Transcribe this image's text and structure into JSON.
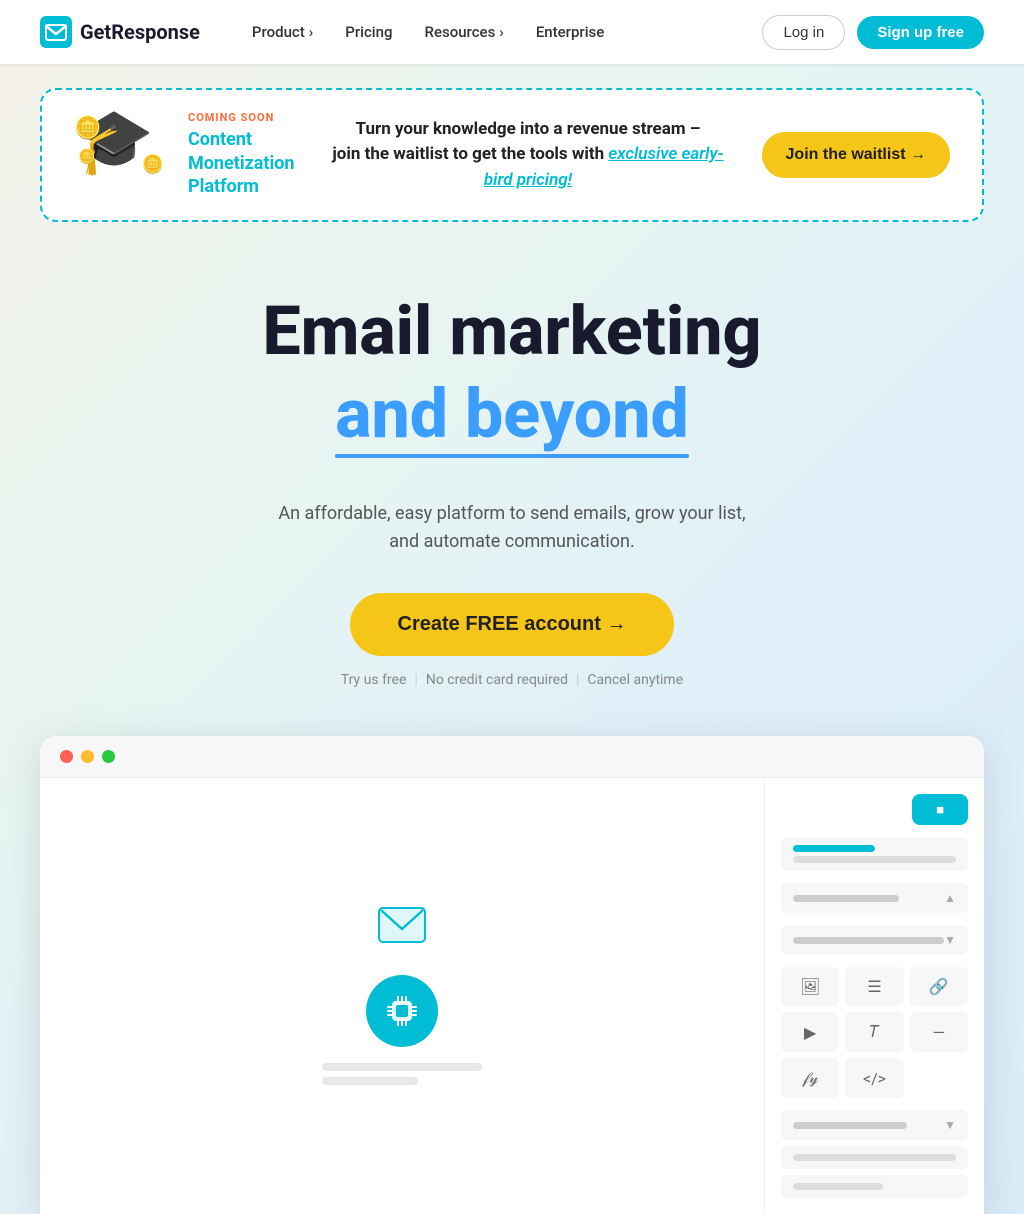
{
  "nav": {
    "logo_text": "GetResponse",
    "links": [
      {
        "label": "Product",
        "has_arrow": true
      },
      {
        "label": "Pricing",
        "has_arrow": false
      },
      {
        "label": "Resources",
        "has_arrow": true
      },
      {
        "label": "Enterprise",
        "has_arrow": false
      }
    ],
    "login_label": "Log in",
    "signup_label": "Sign up free"
  },
  "banner": {
    "coming_soon": "COMING SOON",
    "platform_line1": "Content",
    "platform_line2": "Monetization",
    "platform_line3": "Platform",
    "main_text_before": "Turn your knowledge into a revenue stream –\njoin the waitlist to get the tools with ",
    "main_text_link": "exclusive early-bird pricing!",
    "waitlist_btn": "Join the waitlist →"
  },
  "hero": {
    "title": "Email marketing",
    "subtitle": "and beyond",
    "description_line1": "An affordable, easy platform to send emails, grow your list,",
    "description_line2": "and automate communication.",
    "cta_label": "Create FREE account →",
    "note_parts": [
      "Try us free",
      "|",
      "No credit card required",
      "|",
      "Cancel anytime"
    ]
  },
  "screenshot": {
    "titlebar_dots": [
      "red",
      "yellow",
      "green"
    ]
  }
}
